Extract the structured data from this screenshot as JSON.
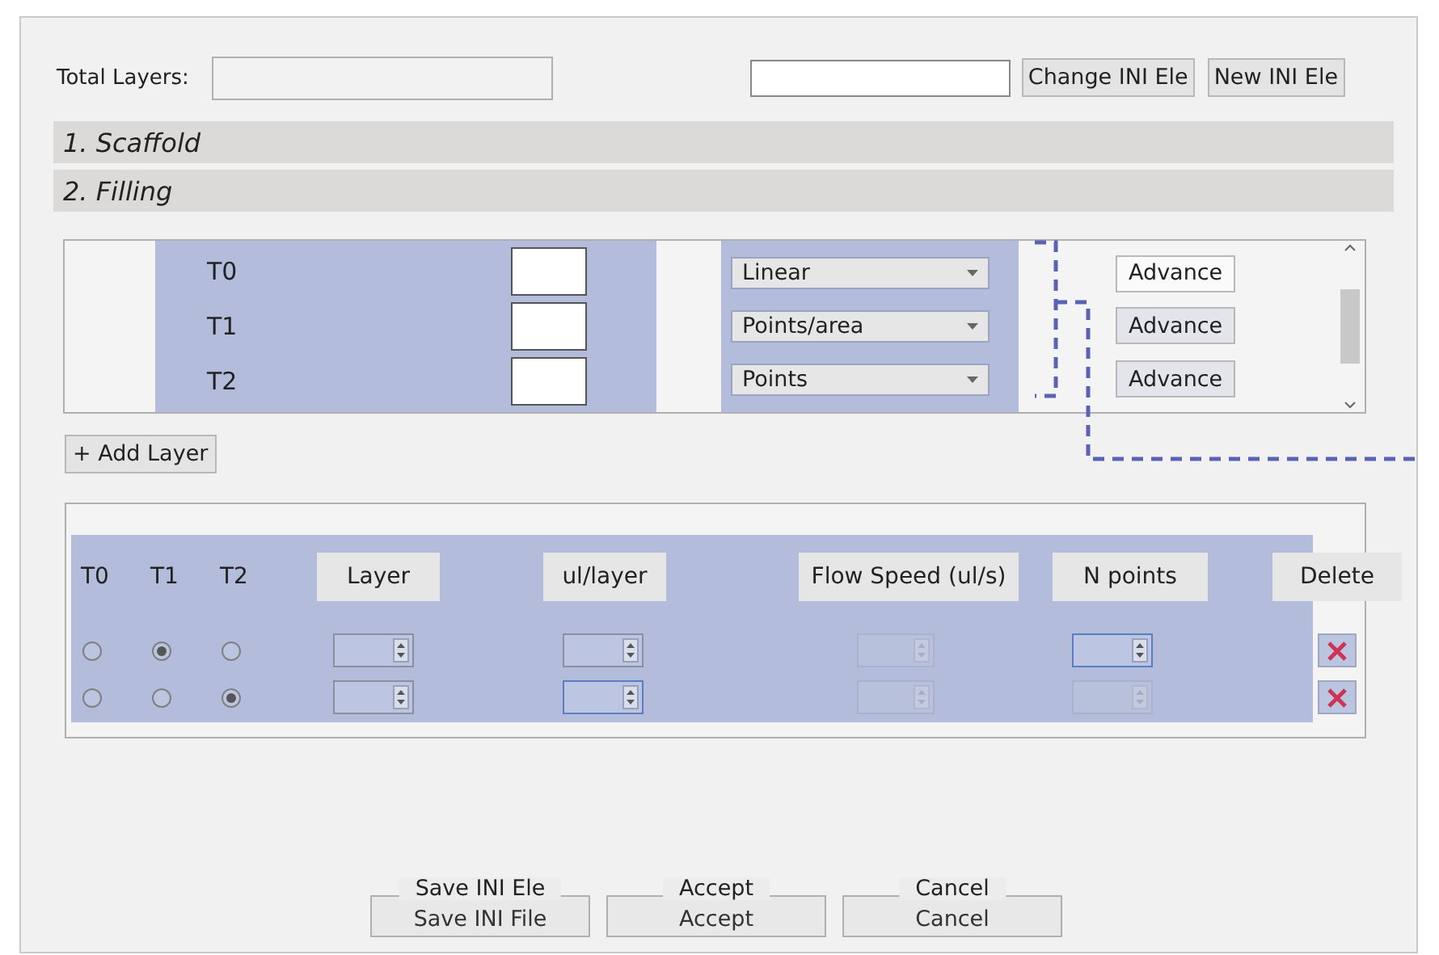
{
  "header": {
    "total_layers_label": "Total Layers:",
    "buttons": [
      "Change INI Ele",
      "New INI Ele"
    ]
  },
  "sections": [
    {
      "title": "1. Scaffold"
    },
    {
      "title": "2. Filling"
    }
  ],
  "tools": [
    {
      "label": "T0",
      "mode": "Linear",
      "button": "Advance",
      "focused": true
    },
    {
      "label": "T1",
      "mode": "Points/area",
      "button": "Advance",
      "focused": false
    },
    {
      "label": "T2",
      "mode": "Points",
      "button": "Advance",
      "focused": false
    }
  ],
  "add_layer_button": "+ Add Layer",
  "layers": {
    "columns": [
      "T0",
      "T1",
      "T2",
      "Layer",
      "ul/layer",
      "Flow Speed (ul/s)",
      "N points",
      "Delete"
    ],
    "rows": [
      {
        "tools": [
          {
            "selected": false
          },
          {
            "selected": true
          },
          {
            "selected": false
          }
        ],
        "spinners": [
          {
            "disabled": false,
            "focused": false
          },
          {
            "disabled": false,
            "focused": false
          },
          {
            "disabled": true,
            "focused": false
          },
          {
            "disabled": false,
            "focused": true
          }
        ]
      },
      {
        "tools": [
          {
            "selected": false
          },
          {
            "selected": false
          },
          {
            "selected": true
          }
        ],
        "spinners": [
          {
            "disabled": false,
            "focused": false
          },
          {
            "disabled": false,
            "focused": true
          },
          {
            "disabled": true,
            "focused": false
          },
          {
            "disabled": true,
            "focused": false
          }
        ]
      }
    ]
  },
  "footer": [
    {
      "label": "Save INI File",
      "overlay": "Save INI Ele"
    },
    {
      "label": "Accept",
      "overlay": "Accept"
    },
    {
      "label": "Cancel",
      "overlay": "Cancel"
    }
  ]
}
